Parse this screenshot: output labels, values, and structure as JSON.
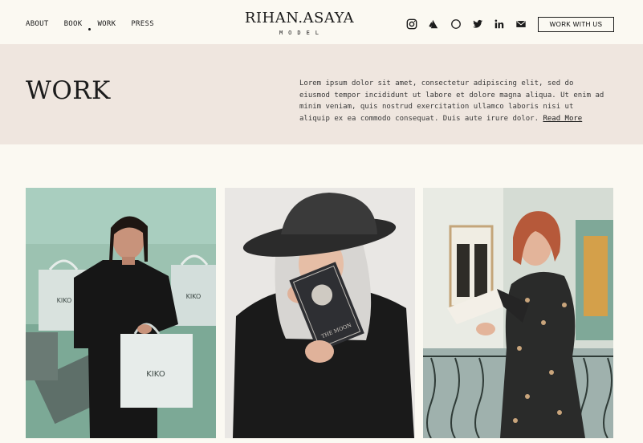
{
  "nav": {
    "items": [
      "ABOUT",
      "BOOK",
      "WORK",
      "PRESS"
    ],
    "active": "WORK"
  },
  "logo": {
    "name": "RIHAN.ASAYA",
    "subtitle": "MODEL"
  },
  "socials": [
    "instagram-icon",
    "artstation-icon",
    "circle-icon",
    "twitter-icon",
    "linkedin-icon",
    "mail-icon"
  ],
  "cta": {
    "label": "WORK WITH US"
  },
  "banner": {
    "title": "WORK",
    "text": "Lorem ipsum dolor sit amet, consectetur adipiscing elit, sed do eiusmod tempor incididunt ut labore et dolore magna aliqua. Ut enim ad minim veniam, quis nostrud exercitation ullamco laboris nisi ut aliquip ex ea commodo consequat. Duis aute irure dolor.",
    "read_more": "Read More"
  },
  "gallery": {
    "bag_text": "KIKO",
    "book_text": "THE MOON"
  },
  "colors": {
    "page_bg": "#fbf9f2",
    "banner_bg": "#efe6df",
    "ink": "#1c1c1c"
  }
}
